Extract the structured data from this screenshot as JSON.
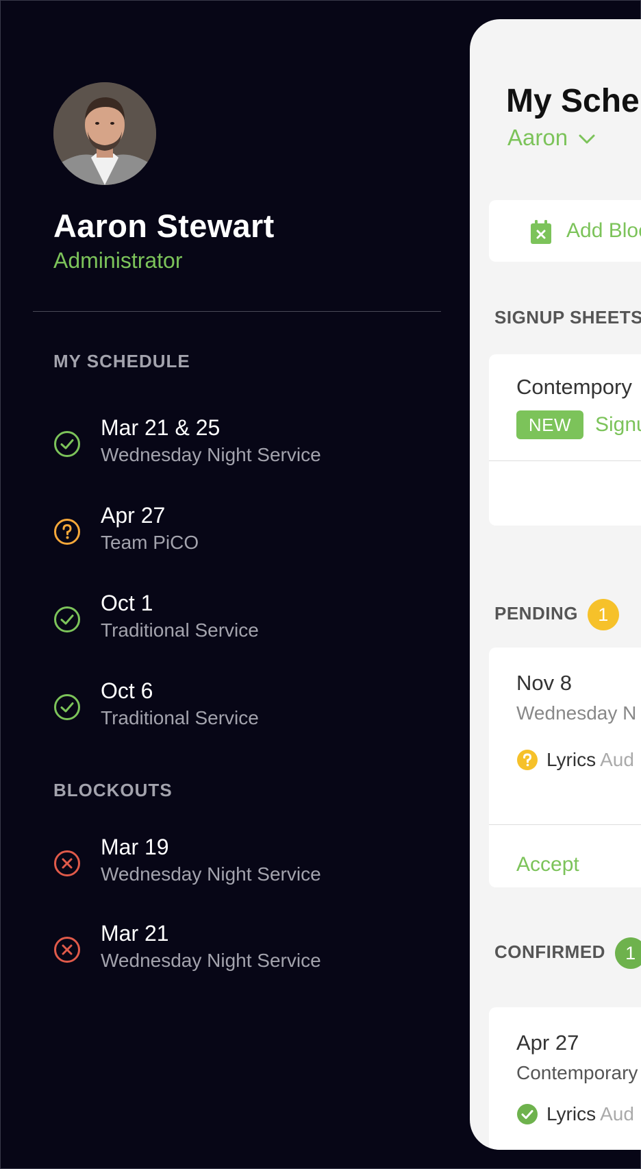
{
  "user": {
    "name": "Aaron Stewart",
    "role": "Administrator"
  },
  "sidebar": {
    "schedule_label": "MY SCHEDULE",
    "schedule": [
      {
        "date": "Mar 21 & 25",
        "event": "Wednesday Night Service",
        "status": "confirmed",
        "icon": "check-circle-icon"
      },
      {
        "date": "Apr 27",
        "event": "Team PiCO",
        "status": "pending",
        "icon": "question-circle-icon"
      },
      {
        "date": "Oct 1",
        "event": "Traditional Service",
        "status": "confirmed",
        "icon": "check-circle-icon"
      },
      {
        "date": "Oct 6",
        "event": "Traditional Service",
        "status": "confirmed",
        "icon": "check-circle-icon"
      }
    ],
    "blockouts_label": "BLOCKOUTS",
    "blockouts": [
      {
        "date": "Mar 19",
        "event": "Wednesday Night Service",
        "icon": "x-circle-icon"
      },
      {
        "date": "Mar 21",
        "event": "Wednesday Night Service",
        "icon": "x-circle-icon"
      }
    ]
  },
  "panel": {
    "title": "My Sche",
    "person_select": "Aaron",
    "add_block_label": "Add Bloc",
    "signup_label": "SIGNUP SHEETS",
    "signup_card": {
      "name": "Contempory",
      "tag": "NEW",
      "link": "Signu"
    },
    "pending_label": "PENDING",
    "pending_count": "1",
    "pending_card": {
      "date": "Nov 8",
      "event": "Wednesday N",
      "role": "Lyrics",
      "role_detail": "Aud",
      "action": "Accept"
    },
    "confirmed_label": "CONFIRMED",
    "confirmed_count": "1",
    "confirmed_card": {
      "date": "Apr 27",
      "event": "Contemporary",
      "role": "Lyrics",
      "role_detail": "Aud"
    }
  },
  "colors": {
    "background": "#070616",
    "accent_green": "#7cc35a",
    "pending_yellow": "#f6c12a",
    "blockout_red": "#e05a4a",
    "panel_bg": "#f4f4f4"
  }
}
